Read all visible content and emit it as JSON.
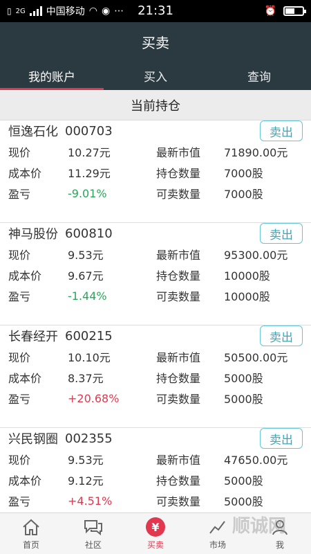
{
  "status_bar": {
    "carrier": "中国移动",
    "time": "21:31",
    "network": "2G",
    "battery_level": 0.55
  },
  "header": {
    "title": "买卖"
  },
  "tabs": [
    {
      "label": "我的账户",
      "active": true
    },
    {
      "label": "买入",
      "active": false
    },
    {
      "label": "查询",
      "active": false
    }
  ],
  "section_title": "当前持仓",
  "labels": {
    "price": "现价",
    "cost": "成本价",
    "pnl": "盈亏",
    "market_value": "最新市值",
    "position": "持仓数量",
    "available": "可卖数量",
    "sell": "卖出"
  },
  "holdings": [
    {
      "name": "恒逸石化",
      "code": "000703",
      "price": "10.27元",
      "cost": "11.29元",
      "pnl": "-9.01%",
      "pnl_sign": "neg",
      "market_value": "71890.00元",
      "position": "7000股",
      "available": "7000股"
    },
    {
      "name": "神马股份",
      "code": "600810",
      "price": "9.53元",
      "cost": "9.67元",
      "pnl": "-1.44%",
      "pnl_sign": "neg",
      "market_value": "95300.00元",
      "position": "10000股",
      "available": "10000股"
    },
    {
      "name": "长春经开",
      "code": "600215",
      "price": "10.10元",
      "cost": "8.37元",
      "pnl": "+20.68%",
      "pnl_sign": "pos",
      "market_value": "50500.00元",
      "position": "5000股",
      "available": "5000股"
    },
    {
      "name": "兴民钢圈",
      "code": "002355",
      "price": "9.53元",
      "cost": "9.12元",
      "pnl": "+4.51%",
      "pnl_sign": "pos",
      "market_value": "47650.00元",
      "position": "5000股",
      "available": "5000股"
    }
  ],
  "bottom_nav": [
    {
      "label": "首页",
      "icon": "home-icon"
    },
    {
      "label": "社区",
      "icon": "chat-icon"
    },
    {
      "label": "买卖",
      "icon": "trade-icon",
      "active": true
    },
    {
      "label": "市场",
      "icon": "market-icon"
    },
    {
      "label": "我",
      "icon": "user-icon"
    }
  ],
  "watermark": "顺诚网",
  "colors": {
    "header_bg": "#2b3a40",
    "accent_red": "#e2384f",
    "gain_green": "#29a65a",
    "sell_border": "#64c6d6"
  }
}
